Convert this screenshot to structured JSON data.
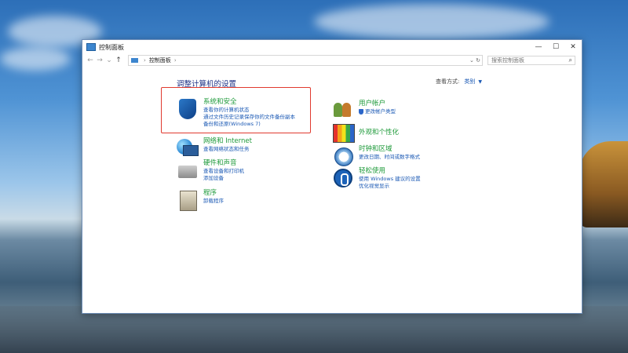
{
  "window": {
    "title": "控制面板",
    "controls": {
      "minimize": "—",
      "maximize": "☐",
      "close": "✕"
    }
  },
  "address": {
    "path": "控制面板",
    "search_placeholder": "搜索控制面板",
    "nav": {
      "back": "←",
      "forward": "→",
      "up": "↑"
    }
  },
  "main": {
    "heading": "调整计算机的设置",
    "view_by": {
      "label": "查看方式:",
      "value": "类别"
    }
  },
  "categories": {
    "system_security": {
      "title": "系统和安全",
      "links": [
        "查看你的计算机状态",
        "通过文件历史记录保存你的文件备份副本",
        "备份和还原(Windows 7)"
      ]
    },
    "network": {
      "title": "网络和 Internet",
      "links": [
        "查看网络状态和任务"
      ]
    },
    "hardware_sound": {
      "title": "硬件和声音",
      "links": [
        "查看设备和打印机",
        "添加设备"
      ]
    },
    "programs": {
      "title": "程序",
      "links": [
        "卸载程序"
      ]
    },
    "user_accounts": {
      "title": "用户帐户",
      "links": [
        "更改帐户类型"
      ]
    },
    "appearance": {
      "title": "外观和个性化",
      "links": []
    },
    "clock_region": {
      "title": "时钟和区域",
      "links": [
        "更改日期、时间或数字格式"
      ]
    },
    "ease_of_access": {
      "title": "轻松使用",
      "links": [
        "使用 Windows 建议的设置",
        "优化视觉显示"
      ]
    }
  },
  "colors": {
    "category_title": "#1e9a3a",
    "link": "#1a58b4",
    "heading": "#1e3287",
    "highlight_box": "#e03a2f"
  }
}
